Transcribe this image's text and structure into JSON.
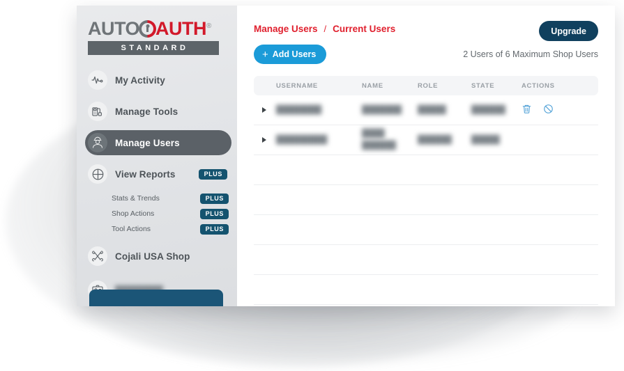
{
  "brand": {
    "logo_auto": "AUTO",
    "logo_auth": "AUTH",
    "registered_mark": "®",
    "tier_bar": "STANDARD"
  },
  "colors": {
    "accent_red": "#e01f2d",
    "accent_blue": "#1b9bd8",
    "navy": "#10405e",
    "badge_navy": "#14536f",
    "active_nav": "#5b6167",
    "icon_blue": "#4d9fd6"
  },
  "sidebar": {
    "items": [
      {
        "label": "My Activity",
        "icon": "activity-pulse-icon",
        "active": false,
        "badge": null
      },
      {
        "label": "Manage Tools",
        "icon": "scan-tool-icon",
        "active": false,
        "badge": null
      },
      {
        "label": "Manage Users",
        "icon": "mechanic-user-icon",
        "active": true,
        "badge": null
      },
      {
        "label": "View Reports",
        "icon": "pie-chart-icon",
        "active": false,
        "badge": "PLUS"
      }
    ],
    "subitems": [
      {
        "label": "Stats & Trends",
        "badge": "PLUS"
      },
      {
        "label": "Shop Actions",
        "badge": "PLUS"
      },
      {
        "label": "Tool Actions",
        "badge": "PLUS"
      }
    ],
    "shop": {
      "label": "Cojali USA Shop",
      "icon": "crossed-wrenches-icon"
    },
    "account": {
      "label": "████████",
      "redacted": true,
      "icon": "id-badge-icon"
    }
  },
  "header": {
    "breadcrumb": {
      "parent": "Manage Users",
      "separator": "/",
      "current": "Current Users"
    },
    "upgrade_label": "Upgrade"
  },
  "toolbar": {
    "add_users_label": "Add Users",
    "add_users_plus": "+",
    "user_count": "2 Users of 6 Maximum Shop Users"
  },
  "table": {
    "columns": [
      "USERNAME",
      "NAME",
      "ROLE",
      "STATE",
      "ACTIONS"
    ],
    "rows": [
      {
        "username": "████████",
        "name": "███████",
        "name2": "",
        "role": "█████",
        "state": "██████",
        "redacted": true,
        "actions": [
          "delete-icon",
          "disable-icon"
        ]
      },
      {
        "username": "█████████",
        "name": "████",
        "name2": "██████",
        "role": "██████",
        "state": "█████",
        "redacted": true,
        "actions": []
      }
    ],
    "empty_row_count": 5
  }
}
